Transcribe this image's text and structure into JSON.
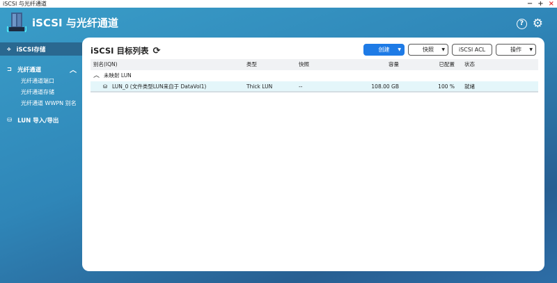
{
  "window": {
    "title": "iSCSI 与光纤通道",
    "controls": [
      "−",
      "+",
      "×"
    ]
  },
  "app": {
    "title": "iSCSI 与光纤通道",
    "help_icon": "help-icon",
    "settings_icon": "gear-icon"
  },
  "sidebar": {
    "items": [
      {
        "label": "iSCSI存储",
        "icon": "iscsi-icon",
        "selected": true
      },
      {
        "label": "光纤通道",
        "icon": "fibre-channel-icon",
        "expanded": true,
        "children": [
          "光纤通道端口",
          "光纤通道存储",
          "光纤通道 WWPN 别名"
        ]
      },
      {
        "label": "LUN 导入/导出",
        "icon": "lun-import-export-icon"
      }
    ]
  },
  "main": {
    "title": "iSCSI 目标列表",
    "toolbar": {
      "create": "创建",
      "snapshot": "快照",
      "acl": "iSCSI ACL",
      "action": "操作"
    },
    "columns": [
      "别名(IQN)",
      "类型",
      "快照",
      "容量",
      "已配置",
      "状态"
    ],
    "group": "未映射 LUN",
    "rows": [
      {
        "alias": "LUN_0 (文件类型LUN来自于 DataVol1)",
        "type": "Thick LUN",
        "snapshot": "--",
        "capacity": "108.00 GB",
        "allocated": "100 %",
        "status": "就绪"
      }
    ]
  },
  "colors": {
    "accent": "#1e7be6",
    "selected_row": "#e4f6fa",
    "sidebar_selected": "#2a6890"
  }
}
